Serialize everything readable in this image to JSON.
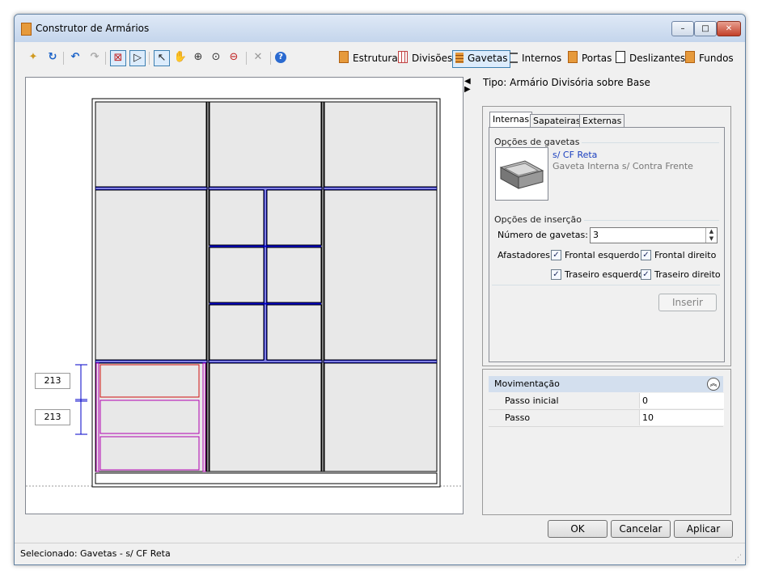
{
  "window": {
    "title": "Construtor de Armários",
    "controls": {
      "minimize": "–",
      "maximize": "□",
      "close": "✕"
    }
  },
  "toolbar": {
    "icons": [
      "new-icon",
      "reset-icon",
      "undo-icon",
      "redo-icon",
      "select-drawer-icon",
      "select-panel-icon",
      "pointer-icon",
      "pan-icon",
      "zoom-in-icon",
      "zoom-window-icon",
      "zoom-out-icon",
      "delete-icon",
      "help-icon"
    ],
    "modes": [
      {
        "label": "Estrutura",
        "icon": "structure-icon"
      },
      {
        "label": "Divisões",
        "icon": "divisions-icon"
      },
      {
        "label": "Gavetas",
        "icon": "drawers-icon",
        "active": true
      },
      {
        "label": "Internos",
        "icon": "internals-icon"
      },
      {
        "label": "Portas",
        "icon": "doors-icon"
      },
      {
        "label": "Deslizantes",
        "icon": "sliding-icon"
      },
      {
        "label": "Fundos",
        "icon": "back-icon"
      }
    ]
  },
  "drawing": {
    "dimensions": [
      "213",
      "213"
    ]
  },
  "info": {
    "tipo": "Tipo: Armário Divisória sobre Base"
  },
  "tabs": [
    "Internas",
    "Sapateiras",
    "Externas"
  ],
  "drawer_options": {
    "group_label": "Opções de gavetas",
    "selected_name": "s/ CF Reta",
    "selected_desc": "Gaveta Interna s/ Contra Frente"
  },
  "insert_options": {
    "group_label": "Opções de inserção",
    "count_label": "Número de gavetas:",
    "count_value": "3",
    "spacers_label": "Afastadores:",
    "checkboxes": [
      {
        "label": "Frontal esquerdo",
        "checked": true
      },
      {
        "label": "Frontal direito",
        "checked": true
      },
      {
        "label": "Traseiro esquerdo",
        "checked": true
      },
      {
        "label": "Traseiro direito",
        "checked": true
      }
    ],
    "insert_button": "Inserir"
  },
  "movimentacao": {
    "title": "Movimentação",
    "rows": [
      {
        "label": "Passo inicial",
        "value": "0"
      },
      {
        "label": "Passo",
        "value": "10"
      }
    ]
  },
  "buttons": {
    "ok": "OK",
    "cancel": "Cancelar",
    "apply": "Aplicar"
  },
  "status": "Selecionado: Gavetas - s/ CF Reta",
  "colors": {
    "division_line": "#0000c8",
    "selected_drawer": "#d01010",
    "drawer_frame": "#b000b0",
    "panel_fill": "#e8e8e8"
  }
}
